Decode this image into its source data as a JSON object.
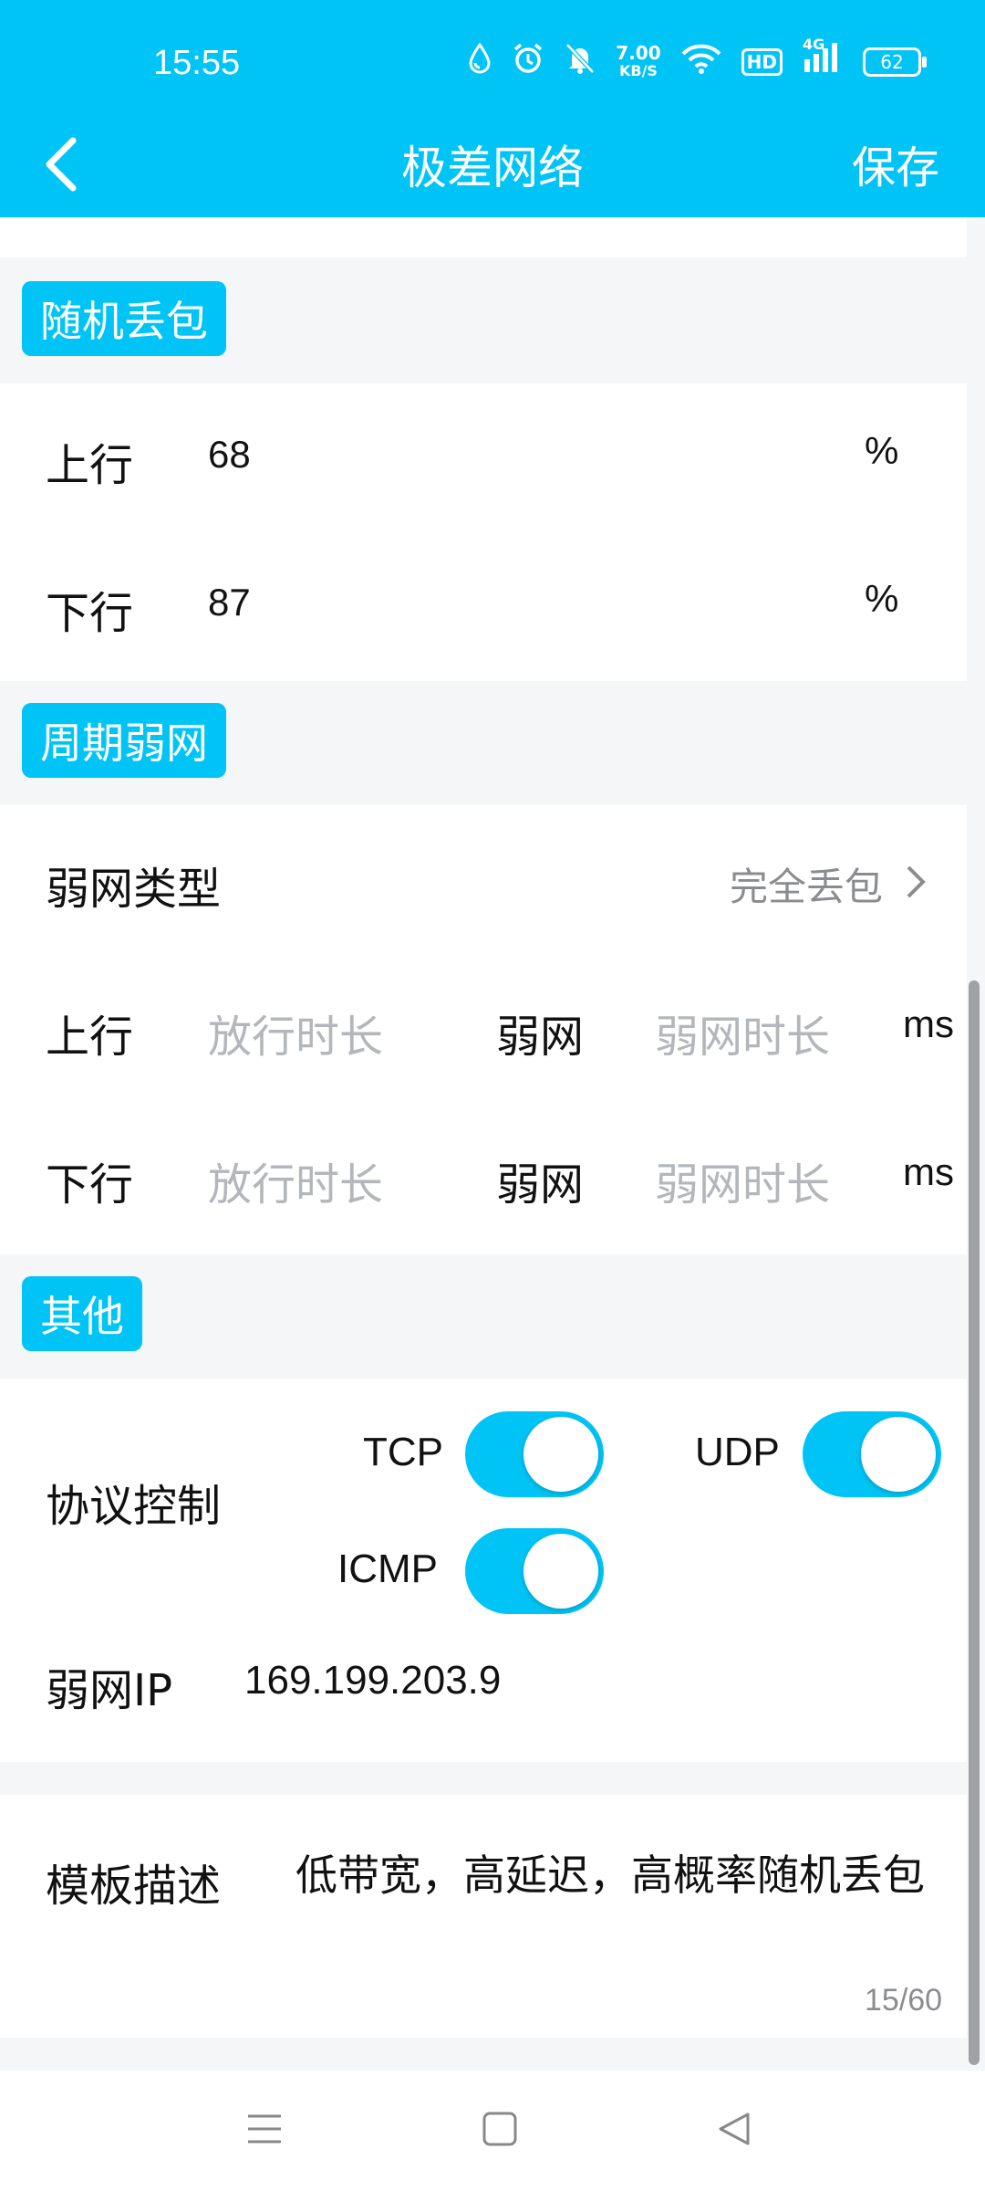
{
  "status": {
    "time": "15:55",
    "net_speed_value": "7.00",
    "net_speed_unit": "KB/S",
    "hd": "HD",
    "signal": "4G",
    "battery": "62"
  },
  "toolbar": {
    "title": "极差网络",
    "save_label": "保存"
  },
  "random_loss": {
    "tag": "随机丢包",
    "up_label": "上行",
    "up_value": "68",
    "up_unit": "%",
    "down_label": "下行",
    "down_value": "87",
    "down_unit": "%"
  },
  "periodic": {
    "tag": "周期弱网",
    "type_label": "弱网类型",
    "type_value": "完全丢包",
    "up_label": "上行",
    "down_label": "下行",
    "pass_placeholder": "放行时长",
    "weak_label": "弱网",
    "weak_placeholder": "弱网时长",
    "unit": "ms"
  },
  "other": {
    "tag": "其他",
    "protocol_label": "协议控制",
    "tcp": "TCP",
    "udp": "UDP",
    "icmp": "ICMP",
    "ip_label": "弱网IP",
    "ip_value": "169.199.203.9"
  },
  "description": {
    "label": "模板描述",
    "text": "低带宽，高延迟，高概率随机丢包",
    "counter": "15/60"
  },
  "colors": {
    "accent": "#00c4f5"
  }
}
